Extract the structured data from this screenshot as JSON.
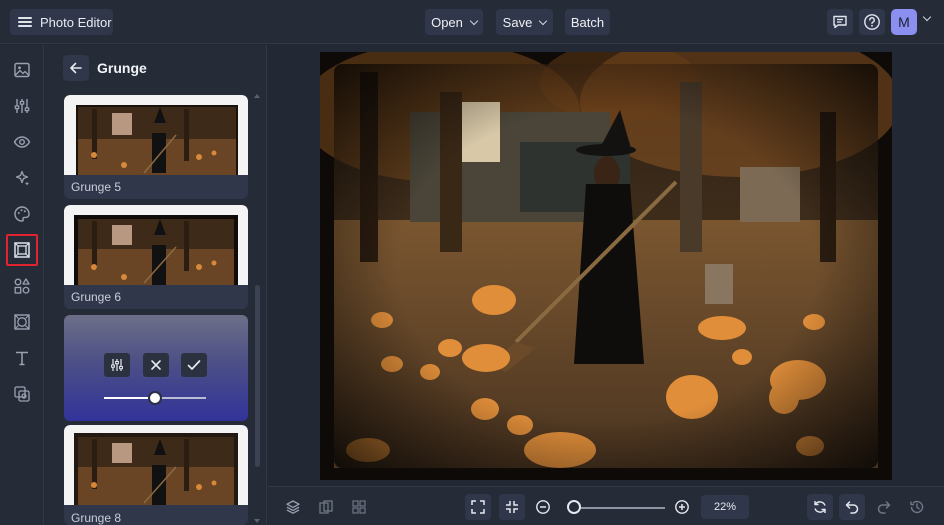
{
  "app": {
    "title": "Photo Editor"
  },
  "toolbar": {
    "open_label": "Open",
    "save_label": "Save",
    "batch_label": "Batch"
  },
  "user": {
    "avatar_initial": "M"
  },
  "rail": {
    "items": [
      {
        "name": "image-icon"
      },
      {
        "name": "adjustments-icon"
      },
      {
        "name": "eye-icon"
      },
      {
        "name": "sparkles-icon"
      },
      {
        "name": "palette-icon"
      },
      {
        "name": "frame-icon",
        "active": true
      },
      {
        "name": "shapes-icon"
      },
      {
        "name": "texture-icon"
      },
      {
        "name": "text-icon"
      },
      {
        "name": "graphics-icon"
      }
    ],
    "active_color": "#e0232e"
  },
  "panel": {
    "title": "Grunge",
    "items": [
      {
        "label": "Grunge 5"
      },
      {
        "label": "Grunge 6"
      },
      {
        "label": "Grunge 8"
      }
    ],
    "active_item": {
      "intensity": 0.5
    }
  },
  "bottom": {
    "zoom_value": "22%",
    "zoom_level": 0.05
  }
}
